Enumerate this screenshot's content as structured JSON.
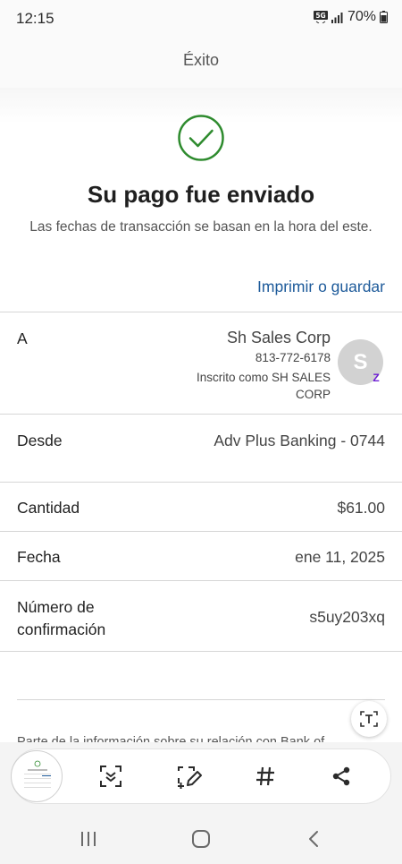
{
  "status_bar": {
    "time": "12:15",
    "network": "5G",
    "battery": "70%"
  },
  "header": {
    "title": "Éxito"
  },
  "confirmation": {
    "icon": "check-circle-icon",
    "title": "Su pago fue enviado",
    "subtitle": "Las fechas de transacción se basan en la hora del este.",
    "print_link": "Imprimir o guardar",
    "accent_color": "#2e8b2e",
    "link_color": "#1d5a9a"
  },
  "details": {
    "to": {
      "label": "A",
      "name": "Sh Sales Corp",
      "phone": "813-772-6178",
      "enrolled": "Inscrito como SH SALES CORP",
      "avatar_initial": "S",
      "badge": "Z"
    },
    "from": {
      "label": "Desde",
      "value": "Adv Plus Banking - 0744"
    },
    "amount": {
      "label": "Cantidad",
      "value": "$61.00"
    },
    "date": {
      "label": "Fecha",
      "value": "ene 11, 2025"
    },
    "confirmation_number": {
      "label": "Número de confirmación",
      "value": "s5uy203xq"
    }
  },
  "footer": {
    "text": "Parte de la información sobre su relación con Bank of"
  },
  "capture_toolbar": {
    "items": [
      "screenshot-thumbnail",
      "scroll-capture-icon",
      "edit-icon",
      "tag-icon",
      "share-icon"
    ]
  },
  "navigation": {
    "items": [
      "recent-apps-icon",
      "home-icon",
      "back-icon"
    ]
  }
}
